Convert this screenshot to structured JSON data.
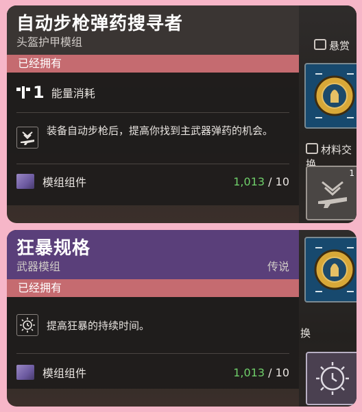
{
  "mods": [
    {
      "title": "自动步枪弹药搜寻者",
      "subtitle": "头盔护甲模组",
      "rarity": "",
      "owned": "已经拥有",
      "energy_value": "1",
      "energy_label": "能量消耗",
      "description": "装备自动步枪后，提高你找到主武器弹药的机会。",
      "material_name": "模组组件",
      "material_have": "1,013",
      "material_need": "/ 10"
    },
    {
      "title": "狂暴规格",
      "subtitle": "武器模组",
      "rarity": "传说",
      "owned": "已经拥有",
      "description": "提高狂暴的持续时间。",
      "material_name": "模组组件",
      "material_have": "1,013",
      "material_need": "/ 10"
    }
  ],
  "side": {
    "bounty_label": "悬赏",
    "exchange_label": "材料交换",
    "exchange_label_cut": "换",
    "tile_badge": "1"
  },
  "colors": {
    "card1_header": "#3a3533",
    "card2_header": "#5a3f7a",
    "owned_bar": "#c56b70",
    "material_count": "#6fcf6a",
    "page_bg": "#f6b6c8"
  },
  "icons": [
    "energy-icon",
    "auto-rifle-perk-icon",
    "mod-component-icon",
    "rampage-timer-icon",
    "bounty-icon",
    "exchange-icon"
  ]
}
